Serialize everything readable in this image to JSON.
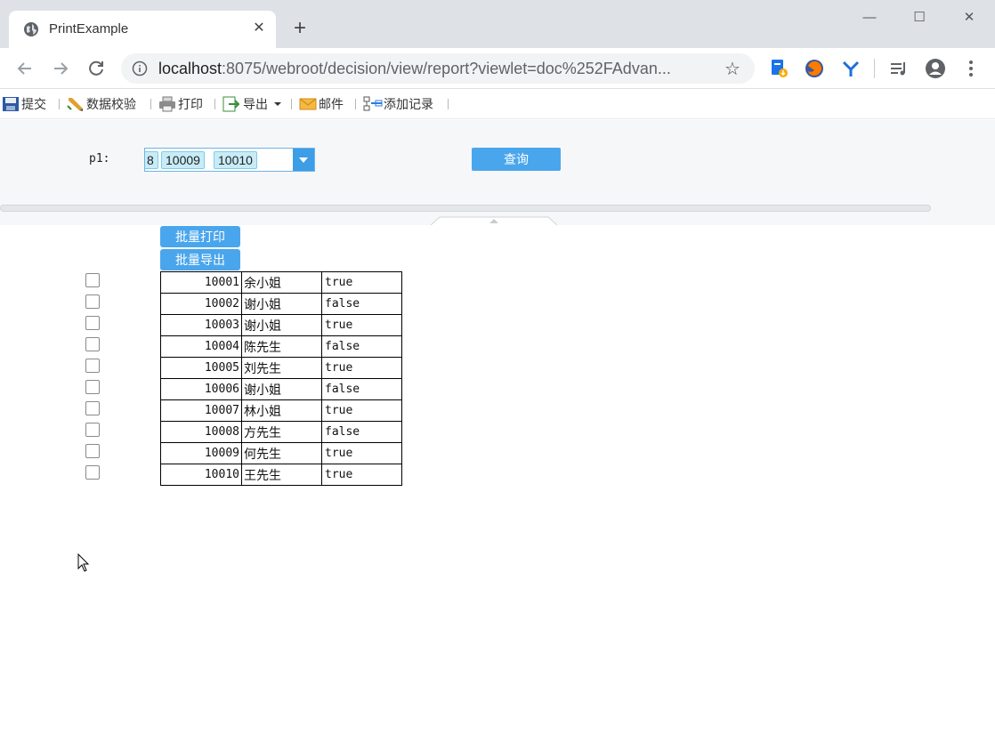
{
  "browser": {
    "tab_title": "PrintExample",
    "tab_close": "✕",
    "new_tab": "+",
    "url_host": "localhost",
    "url_rest": ":8075/webroot/decision/view/report?viewlet=doc%252FAdvan...",
    "window_min": "—",
    "window_max": "☐",
    "window_close": "✕",
    "star": "☆"
  },
  "toolbar": {
    "submit": "提交",
    "validate": "数据校验",
    "print": "打印",
    "export": "导出",
    "mail": "邮件",
    "add_record": "添加记录"
  },
  "params": {
    "p1_label": "p1:",
    "selected": [
      "8",
      "10009",
      "10010"
    ],
    "query_label": "查询"
  },
  "report": {
    "batch_print": "批量打印",
    "batch_export": "批量导出",
    "rows": [
      {
        "id": "10001",
        "name": "余小姐",
        "flag": "true"
      },
      {
        "id": "10002",
        "name": "谢小姐",
        "flag": "false"
      },
      {
        "id": "10003",
        "name": "谢小姐",
        "flag": "true"
      },
      {
        "id": "10004",
        "name": "陈先生",
        "flag": "false"
      },
      {
        "id": "10005",
        "name": "刘先生",
        "flag": "true"
      },
      {
        "id": "10006",
        "name": "谢小姐",
        "flag": "false"
      },
      {
        "id": "10007",
        "name": "林小姐",
        "flag": "true"
      },
      {
        "id": "10008",
        "name": "方先生",
        "flag": "false"
      },
      {
        "id": "10009",
        "name": "何先生",
        "flag": "true"
      },
      {
        "id": "10010",
        "name": "王先生",
        "flag": "true"
      }
    ]
  },
  "colors": {
    "accent": "#4aa6ec",
    "chip_bg": "#c8ecf7"
  }
}
